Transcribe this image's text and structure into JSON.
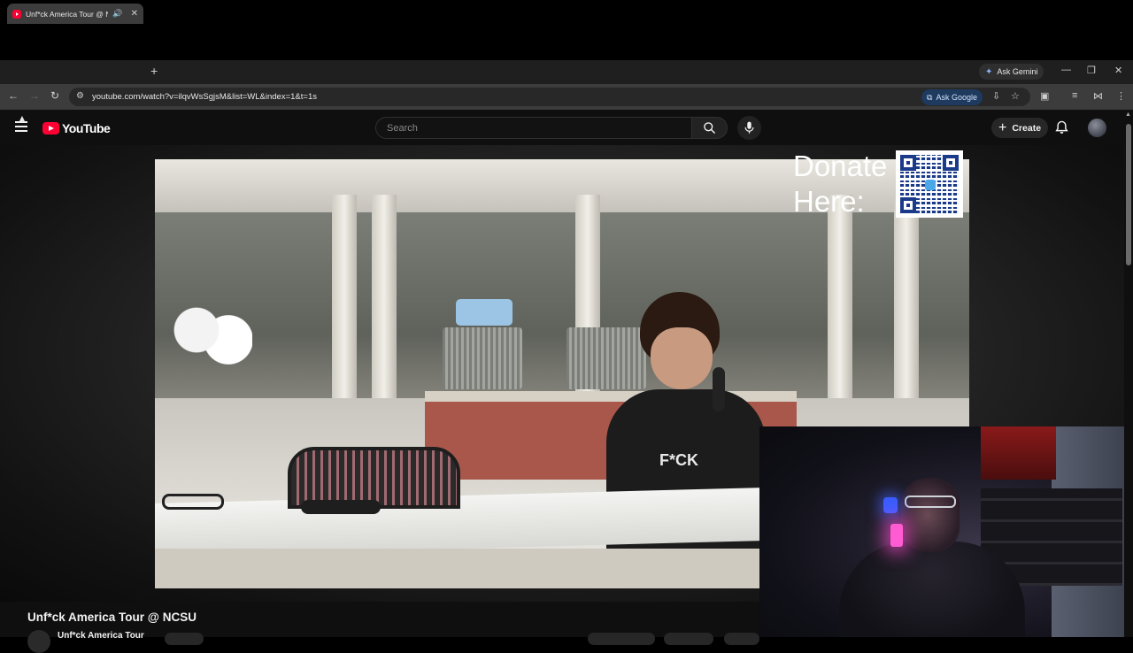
{
  "browser": {
    "tab": {
      "title": "Unf*ck America Tour @ NC",
      "speaker_icon": "🔊",
      "close_icon": "✕"
    },
    "new_tab_icon": "+",
    "gemini": {
      "label": "Ask Gemini",
      "icon": "✦"
    },
    "window_controls": {
      "minimize": "—",
      "restore": "❐",
      "close": "✕"
    },
    "nav": {
      "back": "←",
      "forward": "→",
      "reload": "↻"
    },
    "address": {
      "site_icon": "⚙",
      "url": "youtube.com/watch?v=ilqvWsSgjsM&list=WL&index=1&t=1s"
    },
    "ask_google": {
      "label": "Ask Google",
      "icon": "⧉"
    },
    "toolbar_icons": {
      "install": "⇩",
      "bookmark": "☆",
      "sidepanel": "▣",
      "media": "≡",
      "extension": "⋈",
      "menu": "⋮"
    }
  },
  "youtube": {
    "logo_text": "YouTube",
    "search": {
      "placeholder": "Search",
      "search_icon": "search-icon",
      "mic_icon": "mic-icon"
    },
    "create": {
      "label": "Create",
      "icon": "+"
    },
    "notification_icon": "bell-icon"
  },
  "video": {
    "overlay": {
      "donate_line1": "Donate",
      "donate_line2": "Here:"
    },
    "shirt_text": "F*CK"
  },
  "page": {
    "title": "Unf*ck America Tour @ NCSU",
    "channel_name": "Unf*ck America Tour"
  },
  "colors": {
    "brand_red": "#ff0033",
    "background": "#0f0f0f",
    "ask_google_bg": "#1e3a5f"
  }
}
